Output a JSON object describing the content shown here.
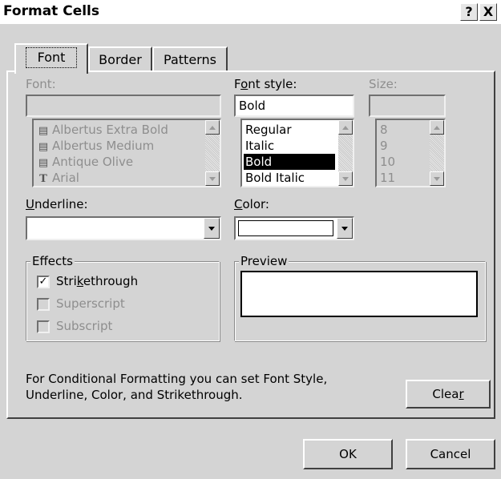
{
  "window": {
    "title": "Format Cells",
    "help_label": "?",
    "close_label": "X"
  },
  "tabs": [
    {
      "label": "Font",
      "active": true
    },
    {
      "label": "Border",
      "active": false
    },
    {
      "label": "Patterns",
      "active": false
    }
  ],
  "font": {
    "label": "Font:",
    "value": "",
    "items": [
      {
        "label": "Albertus Extra Bold",
        "icon": "printer-font-icon"
      },
      {
        "label": "Albertus Medium",
        "icon": "printer-font-icon"
      },
      {
        "label": "Antique Olive",
        "icon": "printer-font-icon"
      },
      {
        "label": "Arial",
        "icon": "truetype-font-icon"
      }
    ]
  },
  "font_style": {
    "label_pre": "F",
    "label_u": "o",
    "label_post": "nt style:",
    "value": "Bold",
    "items": [
      "Regular",
      "Italic",
      "Bold",
      "Bold Italic"
    ],
    "selected": "Bold"
  },
  "size": {
    "label": "Size:",
    "value": "",
    "items": [
      "8",
      "9",
      "10",
      "11"
    ]
  },
  "underline": {
    "label_u": "U",
    "label_post": "nderline:",
    "value": ""
  },
  "color": {
    "label_u": "C",
    "label_post": "olor:",
    "value": ""
  },
  "effects": {
    "title": "Effects",
    "strike_pre": "Stri",
    "strike_u": "k",
    "strike_post": "ethrough",
    "strike_checked": "✓",
    "superscript": "Superscript",
    "subscript": "Subscript"
  },
  "preview": {
    "title": "Preview"
  },
  "info_line1": "For Conditional Formatting you can set Font Style,",
  "info_line2": "Underline, Color, and Strikethrough.",
  "clear": {
    "pre": "Clea",
    "u": "r"
  },
  "ok_label": "OK",
  "cancel_label": "Cancel",
  "colors": {
    "dialog_bg": "#d4d4d4",
    "selection_bg": "#000000",
    "disabled_text": "#8e8e8e"
  }
}
